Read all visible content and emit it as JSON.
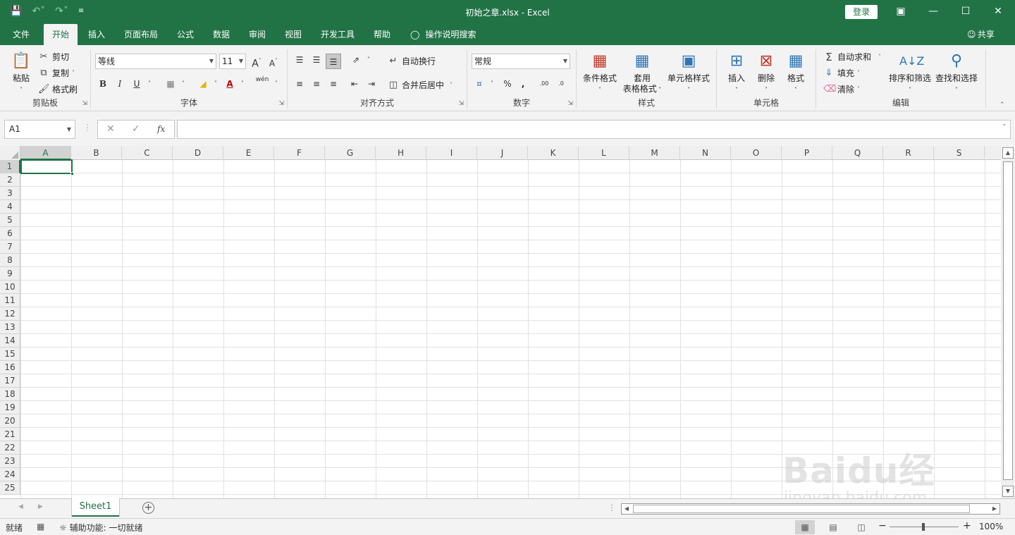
{
  "window": {
    "title": "初始之章.xlsx  -  Excel",
    "login_label": "登录",
    "qat": {
      "save_icon": "save-icon",
      "undo_icon": "undo-icon",
      "redo_icon": "redo-icon",
      "customize_icon": "customize-icon"
    }
  },
  "tabs": [
    {
      "label": "文件"
    },
    {
      "label": "开始"
    },
    {
      "label": "插入"
    },
    {
      "label": "页面布局"
    },
    {
      "label": "公式"
    },
    {
      "label": "数据"
    },
    {
      "label": "审阅"
    },
    {
      "label": "视图"
    },
    {
      "label": "开发工具"
    },
    {
      "label": "帮助"
    }
  ],
  "active_tab": "开始",
  "tell_me": "操作说明搜索",
  "share": "共享",
  "ribbon": {
    "clipboard": {
      "name": "剪贴板",
      "paste": "粘贴",
      "cut": "剪切",
      "copy": "复制",
      "format_painter": "格式刷"
    },
    "font": {
      "name": "字体",
      "font_name": "等线",
      "font_size": "11",
      "bold": "B",
      "italic": "I",
      "underline": "U",
      "phonetic": "wén"
    },
    "alignment": {
      "name": "对齐方式",
      "wrap": "自动换行",
      "merge": "合并后居中"
    },
    "number": {
      "name": "数字",
      "format": "常规",
      "percent": "%",
      "comma": ",",
      "inc_decimal": ".00",
      "dec_decimal": ".0"
    },
    "styles": {
      "name": "样式",
      "conditional": "条件格式",
      "table_line1": "套用",
      "table_line2": "表格格式",
      "cell_styles": "单元格样式"
    },
    "cells": {
      "name": "单元格",
      "insert": "插入",
      "delete": "删除",
      "format": "格式"
    },
    "editing": {
      "name": "编辑",
      "autosum": "自动求和",
      "fill": "填充",
      "clear": "清除",
      "sort": "排序和筛选",
      "find": "查找和选择"
    }
  },
  "formula_bar": {
    "name_box": "A1",
    "fx": "fx",
    "formula": ""
  },
  "grid": {
    "columns": [
      "A",
      "B",
      "C",
      "D",
      "E",
      "F",
      "G",
      "H",
      "I",
      "J",
      "K",
      "L",
      "M",
      "N",
      "O",
      "P",
      "Q",
      "R",
      "S"
    ],
    "rows": [
      "1",
      "2",
      "3",
      "4",
      "5",
      "6",
      "7",
      "8",
      "9",
      "10",
      "11",
      "12",
      "13",
      "14",
      "15",
      "16",
      "17",
      "18",
      "19",
      "20",
      "21",
      "22",
      "23",
      "24",
      "25"
    ],
    "active_cell": "A1"
  },
  "sheets": [
    {
      "name": "Sheet1"
    }
  ],
  "status": {
    "ready": "就绪",
    "accessibility": "辅助功能: 一切就绪",
    "zoom": "100%"
  },
  "watermark": {
    "logo": "Baidu经验",
    "sub": "jingyan.baidu.com"
  }
}
